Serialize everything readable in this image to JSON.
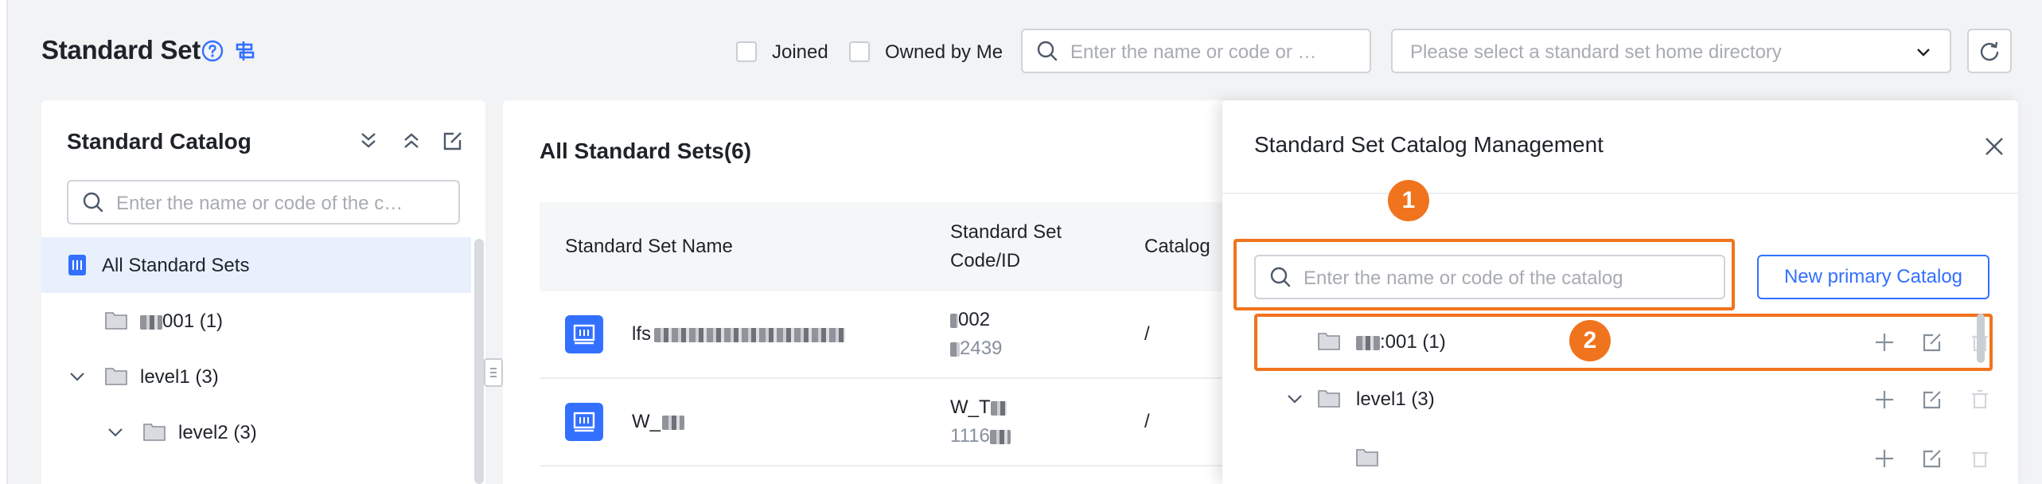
{
  "header": {
    "title": "Standard Set",
    "joined_label": "Joined",
    "owned_label": "Owned by Me",
    "search_placeholder": "Enter the name or code or …",
    "directory_placeholder": "Please select a standard set home directory"
  },
  "catalog": {
    "title": "Standard Catalog",
    "search_placeholder": "Enter the name or code of the c…",
    "items": [
      {
        "label": "All Standard Sets",
        "selected": true
      },
      {
        "label": "001",
        "count": "(1)"
      },
      {
        "label": "level1",
        "count": "(3)"
      },
      {
        "label": "level2",
        "count": "(3)"
      }
    ]
  },
  "main": {
    "title": "All Standard Sets(6)",
    "columns": [
      "Standard Set Name",
      "Standard Set Code/ID",
      "Catalog"
    ],
    "rows": [
      {
        "name_prefix": "lfs",
        "code": "002",
        "id": "2439",
        "catalog": "/"
      },
      {
        "name_prefix": "W_",
        "code": "W_T",
        "id": "1116",
        "catalog": "/"
      }
    ]
  },
  "drawer": {
    "title": "Standard Set Catalog Management",
    "search_placeholder": "Enter the name or code of the catalog",
    "new_button": "New primary Catalog",
    "badge1": "1",
    "badge2": "2",
    "rows": [
      {
        "label": ":001",
        "count": "(1)"
      },
      {
        "label": "level1",
        "count": "(3)"
      }
    ]
  },
  "colors": {
    "accent": "#3370ff",
    "highlight": "#f0741e"
  }
}
